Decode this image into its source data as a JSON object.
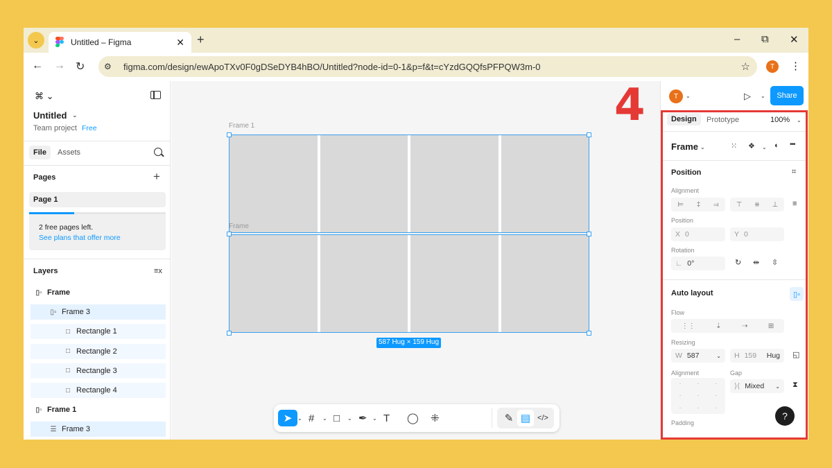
{
  "browser": {
    "tab_title": "Untitled – Figma",
    "url": "figma.com/design/ewApoTXv0F0gDSeDYB4hBO/Untitled?node-id=0-1&p=f&t=cYzdGQQfsPFPQW3m-0",
    "profile_initial": "T",
    "new_tab": "+",
    "minimize": "–",
    "maximize": "⧉",
    "close": "✕",
    "back": "←",
    "forward": "→",
    "reload": "↻",
    "site_icon": "⚙",
    "star": "☆",
    "menu": "⋮",
    "tab_menu": "⌄",
    "tab_close": "✕"
  },
  "left_panel": {
    "logo": "⌘ ⌄",
    "file_name": "Untitled",
    "file_caret": "⌄",
    "team": "Team project",
    "plan_badge": "Free",
    "tab_file": "File",
    "tab_assets": "Assets",
    "pages_title": "Pages",
    "plus": "+",
    "current_page": "Page 1",
    "pages_used_fraction": 0.33,
    "promo_text": "2 free pages left.",
    "promo_link": "See plans that offer more",
    "layers_title": "Layers",
    "layers_icon": "≡x",
    "layers": [
      {
        "name": "Frame",
        "icon": "▯▫",
        "level": 0,
        "bold": true,
        "state": "none"
      },
      {
        "name": "Frame 3",
        "icon": "▯▫",
        "level": 1,
        "bold": false,
        "state": "selected"
      },
      {
        "name": "Rectangle 1",
        "icon": "□",
        "level": 2,
        "bold": false,
        "state": "inset"
      },
      {
        "name": "Rectangle 2",
        "icon": "□",
        "level": 2,
        "bold": false,
        "state": "inset"
      },
      {
        "name": "Rectangle 3",
        "icon": "□",
        "level": 2,
        "bold": false,
        "state": "inset"
      },
      {
        "name": "Rectangle 4",
        "icon": "□",
        "level": 2,
        "bold": false,
        "state": "inset"
      },
      {
        "name": "Frame 1",
        "icon": "▯▫",
        "level": 0,
        "bold": true,
        "state": "none"
      },
      {
        "name": "Frame 3",
        "icon": "☰",
        "level": 1,
        "bold": false,
        "state": "selected"
      }
    ]
  },
  "canvas": {
    "frame1_label": "Frame 1",
    "frame_label": "Frame",
    "size_badge": "587 Hug × 159 Hug",
    "tools": [
      {
        "name": "move-tool",
        "glyph": "➤",
        "caret": true,
        "active": true
      },
      {
        "name": "frame-tool",
        "glyph": "#",
        "caret": true,
        "active": false
      },
      {
        "name": "shape-tool",
        "glyph": "□",
        "caret": true,
        "active": false
      },
      {
        "name": "pen-tool",
        "glyph": "✒",
        "caret": true,
        "active": false
      },
      {
        "name": "text-tool",
        "glyph": "T",
        "caret": false,
        "active": false
      },
      {
        "name": "comment-tool",
        "glyph": "◯",
        "caret": false,
        "active": false
      },
      {
        "name": "actions-tool",
        "glyph": "⁜",
        "caret": false,
        "active": false
      }
    ],
    "dev_tools": [
      "✎",
      "▤",
      "</>"
    ]
  },
  "right_panel": {
    "user_initial": "T",
    "play": "▷",
    "share": "Share",
    "tab_design": "Design",
    "tab_prototype": "Prototype",
    "zoom": "100%",
    "caret": "⌄",
    "frame_type": "Frame",
    "frame_icons": [
      "⁙",
      "❖",
      "◐",
      "•••"
    ],
    "position_title": "Position",
    "alignment_label": "Alignment",
    "align_icons": [
      "⊨",
      "‡",
      "⫤",
      "⊤",
      "⧺",
      "⊥",
      "≡"
    ],
    "position_label": "Position",
    "x_label": "X",
    "x_value": "0",
    "y_label": "Y",
    "y_value": "0",
    "rotation_label": "Rotation",
    "rotation_icon": "∟",
    "rotation_value": "0°",
    "rotation_icons": [
      "↻",
      "⇹",
      "⇳"
    ],
    "auto_layout_title": "Auto layout",
    "auto_layout_icon": "▯▫",
    "flow_label": "Flow",
    "flow_icons": [
      "⋮⋮",
      "⇣",
      "⇢",
      "⊞"
    ],
    "resizing_label": "Resizing",
    "w_label": "W",
    "w_value": "587",
    "h_label": "H",
    "h_value": "159",
    "h_mode": "Hug",
    "resize_icon": "◱",
    "alignment2_label": "Alignment",
    "gap_label": "Gap",
    "gap_icon": "⟩⟨",
    "gap_value": "Mixed",
    "gap_settings_icon": "⧗",
    "padding_label": "Padding",
    "help": "?"
  },
  "annotation": {
    "step_number": "4"
  }
}
